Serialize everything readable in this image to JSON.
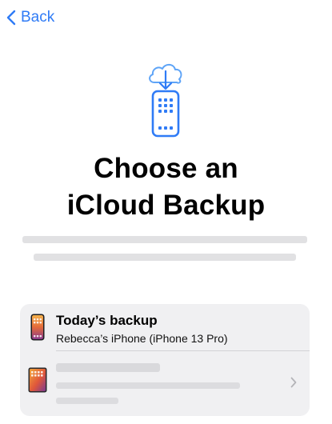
{
  "nav": {
    "back_label": "Back",
    "accent_color": "#2f7bf6"
  },
  "hero": {
    "icon": "icloud-download-to-iphone-icon"
  },
  "title": {
    "line1": "Choose an",
    "line2": "iCloud Backup"
  },
  "backups": [
    {
      "title": "Today’s backup",
      "subtitle": "Rebecca’s iPhone (iPhone 13 Pro)",
      "device_icon": "iphone-icon"
    },
    {
      "title": "",
      "subtitle": "",
      "device_icon": "ipad-icon",
      "accessory_icon": "chevron-right-icon"
    }
  ]
}
